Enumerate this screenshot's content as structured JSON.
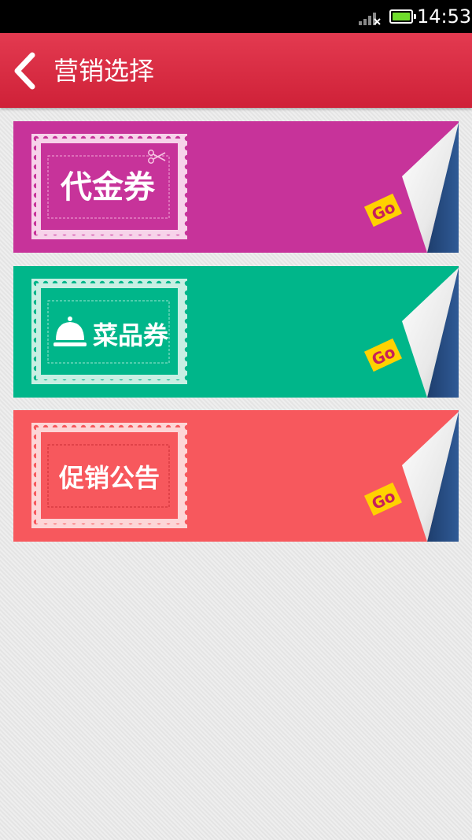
{
  "status_bar": {
    "time": "14:53",
    "icons": [
      "signal-icon",
      "battery-icon"
    ],
    "battery_color": "#6fdc2c"
  },
  "header": {
    "title": "营销选择",
    "back_icon": "back-chevron-icon",
    "color": "#d9283f"
  },
  "cards": [
    {
      "label": "代金券",
      "go_text": "Go",
      "color": "#c7339a",
      "icon": "scissors-icon"
    },
    {
      "label": "菜品券",
      "go_text": "Go",
      "color": "#00b68a",
      "icon": "food-cloche-icon"
    },
    {
      "label": "促销公告",
      "go_text": "Go",
      "color": "#f7585d",
      "icon": null
    }
  ]
}
